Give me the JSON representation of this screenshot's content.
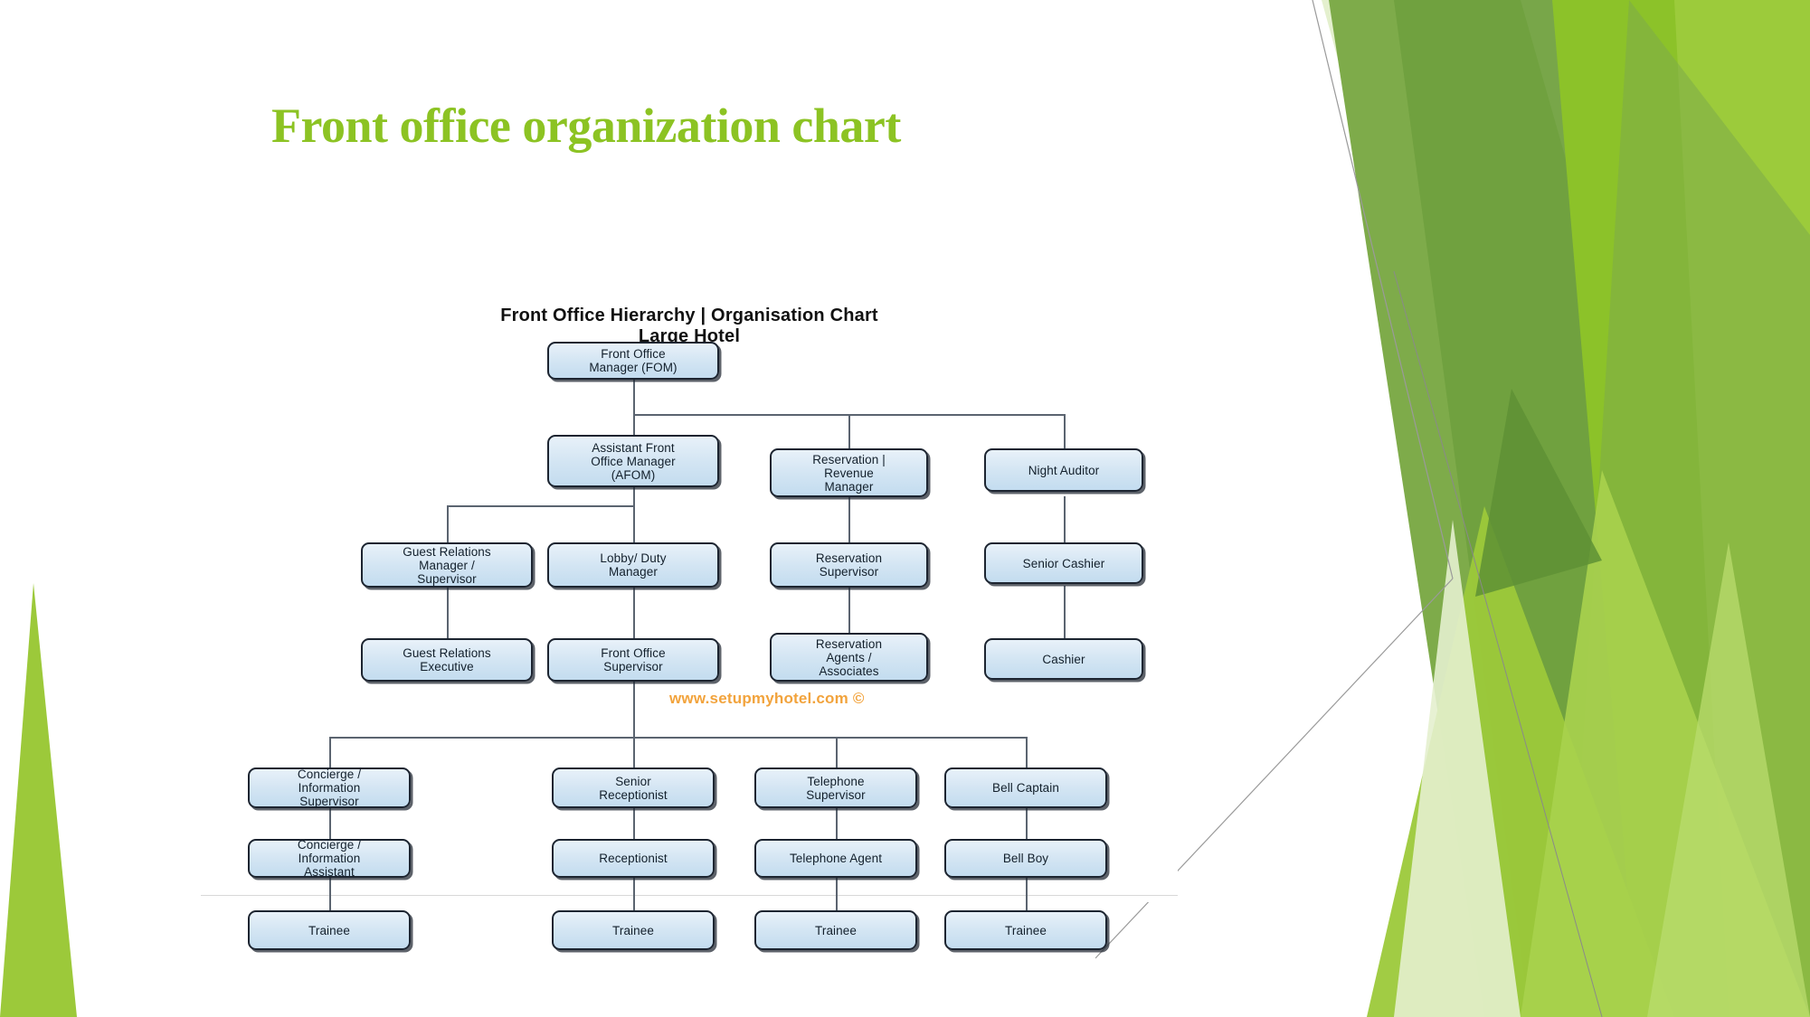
{
  "slide": {
    "title": "Front office organization chart",
    "title_color": "#8CC323",
    "background_color": "#FFFFFF"
  },
  "chart_image": {
    "heading_line1": "Front Office Hierarchy | Organisation Chart",
    "heading_line2": "Large Hotel",
    "watermark": "www.setupmyhotel.com ©",
    "watermark_color": "#F2A33C",
    "node_fill_color": "#D3E5F3",
    "node_border_color": "#1C2430",
    "connector_color": "#5B6470"
  },
  "chart_data": {
    "type": "diagram",
    "title": "Front Office Hierarchy | Organisation Chart Large Hotel",
    "orientation": "top-down",
    "nodes": [
      {
        "id": "fom",
        "label": "Front  Office\nManager (FOM)",
        "level": 0
      },
      {
        "id": "afom",
        "label": "Assistant Front\nOffice Manager\n(AFOM)",
        "level": 1
      },
      {
        "id": "resv_mgr",
        "label": "Reservation |\nRevenue\nManager",
        "level": 1
      },
      {
        "id": "night_auditor",
        "label": "Night Auditor",
        "level": 1
      },
      {
        "id": "grm",
        "label": "Guest Relations\nManager /\nSupervisor",
        "level": 2
      },
      {
        "id": "lobby_mgr",
        "label": "Lobby/ Duty\nManager",
        "level": 2
      },
      {
        "id": "resv_sup",
        "label": "Reservation\nSupervisor",
        "level": 2
      },
      {
        "id": "sr_cashier",
        "label": "Senior Cashier",
        "level": 2
      },
      {
        "id": "gre",
        "label": "Guest Relations\nExecutive",
        "level": 3
      },
      {
        "id": "fo_sup",
        "label": "Front Office\nSupervisor",
        "level": 3
      },
      {
        "id": "resv_agents",
        "label": "Reservation\nAgents /\nAssociates",
        "level": 3
      },
      {
        "id": "cashier",
        "label": "Cashier",
        "level": 3
      },
      {
        "id": "concierge_sup",
        "label": "Concierge /\nInformation\nSupervisor",
        "level": 4
      },
      {
        "id": "sr_recep",
        "label": "Senior\nReceptionist",
        "level": 4
      },
      {
        "id": "tel_sup",
        "label": "Telephone\nSupervisor",
        "level": 4
      },
      {
        "id": "bell_captain",
        "label": "Bell Captain",
        "level": 4
      },
      {
        "id": "concierge_asst",
        "label": "Concierge /\nInformation\nAssistant",
        "level": 5
      },
      {
        "id": "recep",
        "label": "Receptionist",
        "level": 5
      },
      {
        "id": "tel_agent",
        "label": "Telephone Agent",
        "level": 5
      },
      {
        "id": "bell_boy",
        "label": "Bell Boy",
        "level": 5
      },
      {
        "id": "trainee1",
        "label": "Trainee",
        "level": 6
      },
      {
        "id": "trainee2",
        "label": "Trainee",
        "level": 6
      },
      {
        "id": "trainee3",
        "label": "Trainee",
        "level": 6
      },
      {
        "id": "trainee4",
        "label": "Trainee",
        "level": 6
      }
    ],
    "edges": [
      [
        "fom",
        "afom"
      ],
      [
        "fom",
        "resv_mgr"
      ],
      [
        "fom",
        "night_auditor"
      ],
      [
        "afom",
        "grm"
      ],
      [
        "afom",
        "lobby_mgr"
      ],
      [
        "resv_mgr",
        "resv_sup"
      ],
      [
        "night_auditor",
        "sr_cashier"
      ],
      [
        "grm",
        "gre"
      ],
      [
        "lobby_mgr",
        "fo_sup"
      ],
      [
        "resv_sup",
        "resv_agents"
      ],
      [
        "sr_cashier",
        "cashier"
      ],
      [
        "fo_sup",
        "concierge_sup"
      ],
      [
        "fo_sup",
        "sr_recep"
      ],
      [
        "fo_sup",
        "tel_sup"
      ],
      [
        "fo_sup",
        "bell_captain"
      ],
      [
        "concierge_sup",
        "concierge_asst"
      ],
      [
        "sr_recep",
        "recep"
      ],
      [
        "tel_sup",
        "tel_agent"
      ],
      [
        "bell_captain",
        "bell_boy"
      ],
      [
        "concierge_asst",
        "trainee1"
      ],
      [
        "recep",
        "trainee2"
      ],
      [
        "tel_agent",
        "trainee3"
      ],
      [
        "bell_boy",
        "trainee4"
      ]
    ]
  },
  "decorations": {
    "green_palette": [
      "#7EAB4A",
      "#6F9F3E",
      "#8CC229",
      "#9CCB3B",
      "#A8D24E",
      "#B9DC6E",
      "#E4F0CE",
      "#5E9135"
    ],
    "left_spike_color": "#9CC93A"
  }
}
